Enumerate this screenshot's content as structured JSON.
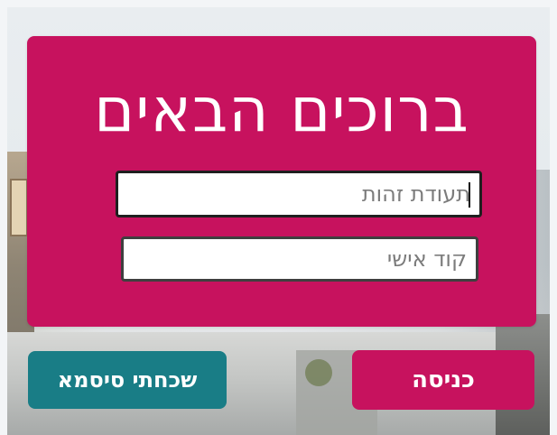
{
  "login": {
    "title": "ברוכים הבאים",
    "id_field": {
      "value": "",
      "placeholder": "תעודת זהות"
    },
    "code_field": {
      "value": "",
      "placeholder": "קוד אישי"
    },
    "enter_label": "כניסה",
    "forgot_label": "שכחתי סיסמא",
    "colors": {
      "primary": "#c7125e",
      "secondary": "#197d86",
      "text": "#ffffff"
    }
  }
}
